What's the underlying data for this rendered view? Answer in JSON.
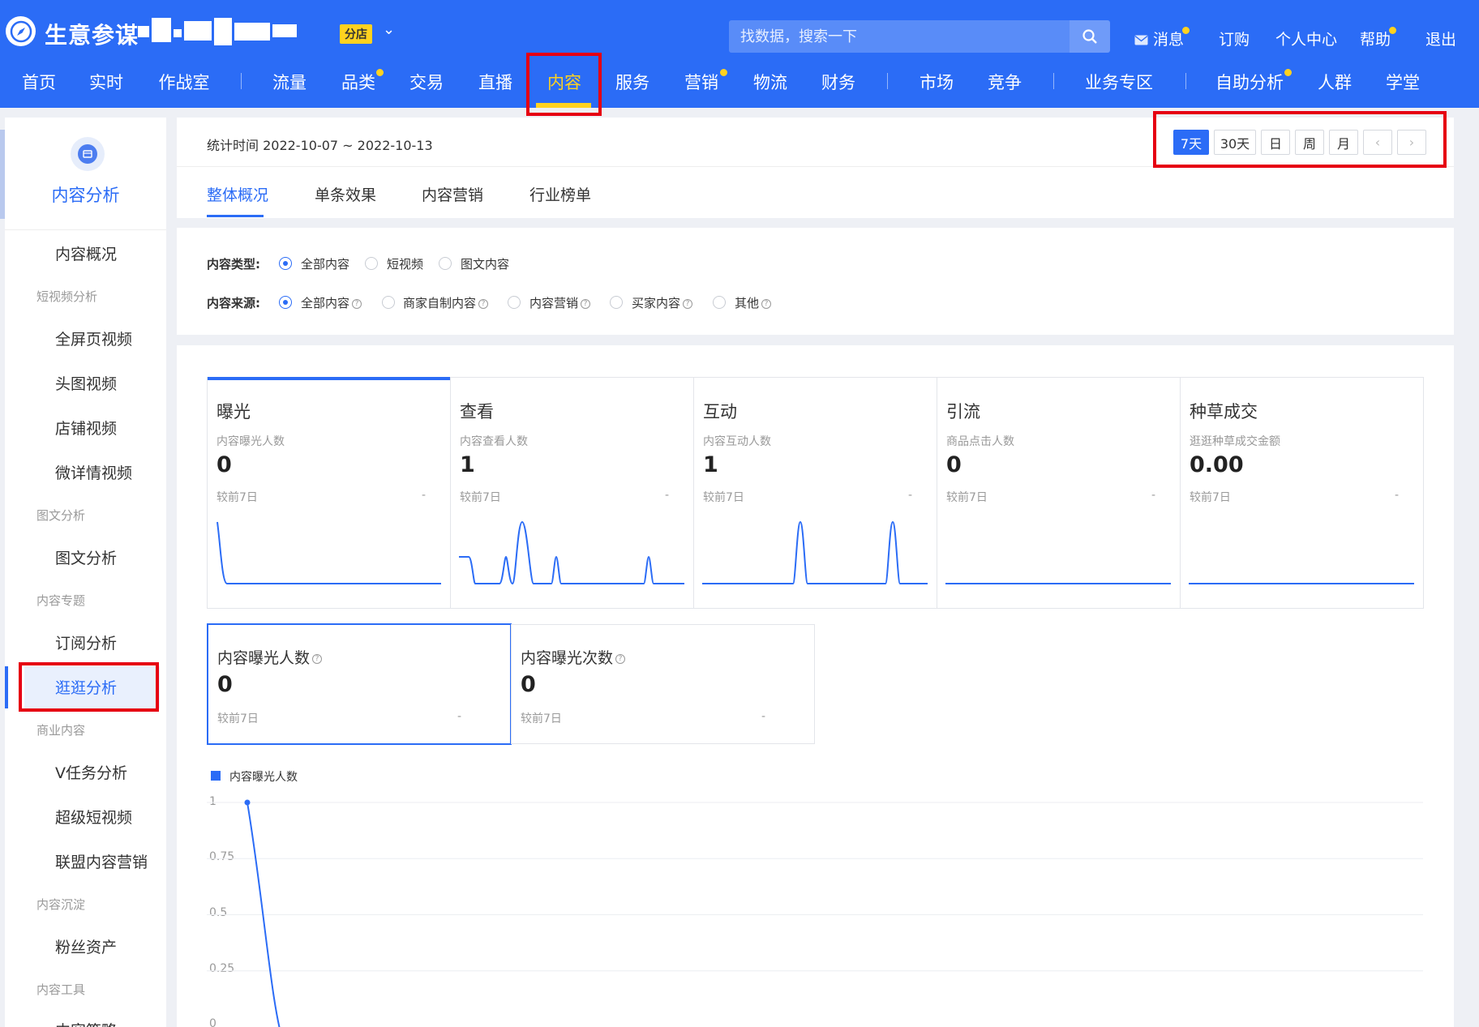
{
  "header": {
    "brand": "生意参谋",
    "branch_badge": "分店",
    "search_placeholder": "找数据，搜索一下",
    "links": {
      "messages": "消息",
      "subscribe": "订购",
      "personal_center": "个人中心",
      "help": "帮助",
      "logout": "退出"
    },
    "nav": [
      {
        "label": "首页"
      },
      {
        "label": "实时"
      },
      {
        "label": "作战室"
      },
      {
        "label": "流量"
      },
      {
        "label": "品类"
      },
      {
        "label": "交易"
      },
      {
        "label": "直播"
      },
      {
        "label": "内容"
      },
      {
        "label": "服务"
      },
      {
        "label": "营销"
      },
      {
        "label": "物流"
      },
      {
        "label": "财务"
      },
      {
        "label": "市场"
      },
      {
        "label": "竞争"
      },
      {
        "label": "业务专区"
      },
      {
        "label": "自助分析"
      },
      {
        "label": "人群"
      },
      {
        "label": "学堂"
      }
    ],
    "accent": "#2b6cf6",
    "highlight": "#ffd21f"
  },
  "sidebar": {
    "title": "内容分析",
    "items": {
      "overview": "内容概况",
      "g_short_video": "短视频分析",
      "fullscreen": "全屏页视频",
      "head_video": "头图视频",
      "shop_video": "店铺视频",
      "micro_detail": "微详情视频",
      "g_graphic": "图文分析",
      "graphic": "图文分析",
      "g_topic": "内容专题",
      "subscription": "订阅分析",
      "guangguang": "逛逛分析",
      "g_business": "商业内容",
      "v_task": "V任务分析",
      "super_short": "超级短视频",
      "alliance": "联盟内容营销",
      "g_deposit": "内容沉淀",
      "fans": "粉丝资产",
      "g_tools": "内容工具",
      "strategy": "内容策略"
    }
  },
  "main": {
    "stat_time": "统计时间 2022-10-07 ~ 2022-10-13",
    "date_buttons": {
      "d7": "7天",
      "d30": "30天",
      "day": "日",
      "week": "周",
      "month": "月",
      "prev": "‹",
      "next": "›"
    },
    "tabs": {
      "overall": "整体概况",
      "single": "单条效果",
      "marketing": "内容营销",
      "ranking": "行业榜单"
    },
    "filters": {
      "type_label": "内容类型:",
      "type_options": {
        "all": "全部内容",
        "short_video": "短视频",
        "graphic": "图文内容"
      },
      "source_label": "内容来源:",
      "source_options": {
        "all": "全部内容",
        "merchant": "商家自制内容",
        "marketing": "内容营销",
        "buyer": "买家内容",
        "other": "其他"
      }
    },
    "cards": [
      {
        "title": "曝光",
        "sub": "内容曝光人数",
        "value": "0",
        "compare": "较前7日",
        "dash": "-"
      },
      {
        "title": "查看",
        "sub": "内容查看人数",
        "value": "1",
        "compare": "较前7日",
        "dash": "-"
      },
      {
        "title": "互动",
        "sub": "内容互动人数",
        "value": "1",
        "compare": "较前7日",
        "dash": "-"
      },
      {
        "title": "引流",
        "sub": "商品点击人数",
        "value": "0",
        "compare": "较前7日",
        "dash": "-"
      },
      {
        "title": "种草成交",
        "sub": "逛逛种草成交金额",
        "value": "0.00",
        "compare": "较前7日",
        "dash": "-"
      }
    ],
    "sub_cards": [
      {
        "title": "内容曝光人数",
        "value": "0",
        "compare": "较前7日",
        "dash": "-"
      },
      {
        "title": "内容曝光次数",
        "value": "0",
        "compare": "较前7日",
        "dash": "-"
      }
    ]
  },
  "chart_data": {
    "type": "line",
    "series": [
      {
        "name": "内容曝光人数",
        "values": [
          1,
          0
        ]
      }
    ],
    "y_ticks": [
      "1",
      "0.75",
      "0.5",
      "0.25",
      "0"
    ],
    "ylim": [
      0,
      1
    ],
    "grid": true,
    "legend": "top-left"
  }
}
